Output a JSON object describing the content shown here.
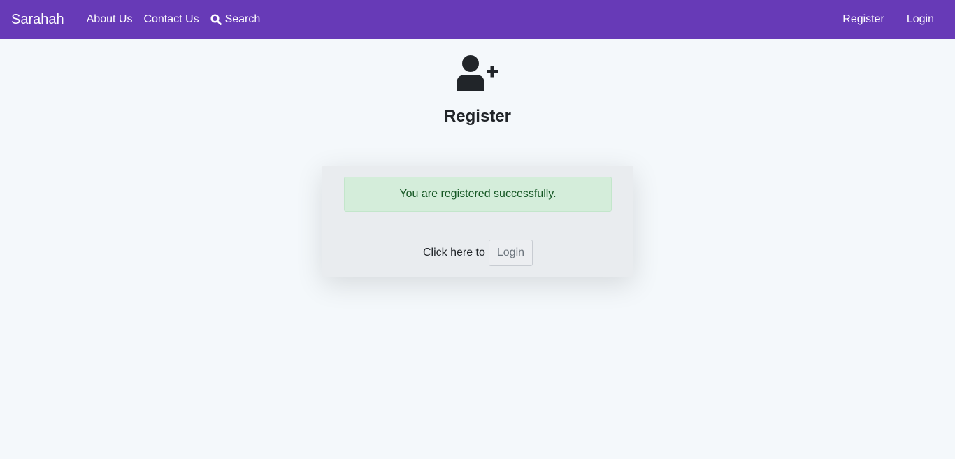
{
  "navbar": {
    "brand": "Sarahah",
    "left_links": [
      {
        "label": "About Us"
      },
      {
        "label": "Contact Us"
      },
      {
        "label": "Search",
        "icon": "search-icon"
      }
    ],
    "right_links": [
      {
        "label": "Register"
      },
      {
        "label": "Login"
      }
    ],
    "background_color": "#673ab7"
  },
  "header": {
    "icon": "user-plus-icon",
    "title": "Register"
  },
  "card": {
    "alert_message": "You are registered successfully.",
    "login_prompt": "Click here to",
    "login_button_label": "Login"
  },
  "colors": {
    "page_background": "#f4f8fb",
    "alert_background": "#d4edda",
    "alert_text": "#155724"
  }
}
